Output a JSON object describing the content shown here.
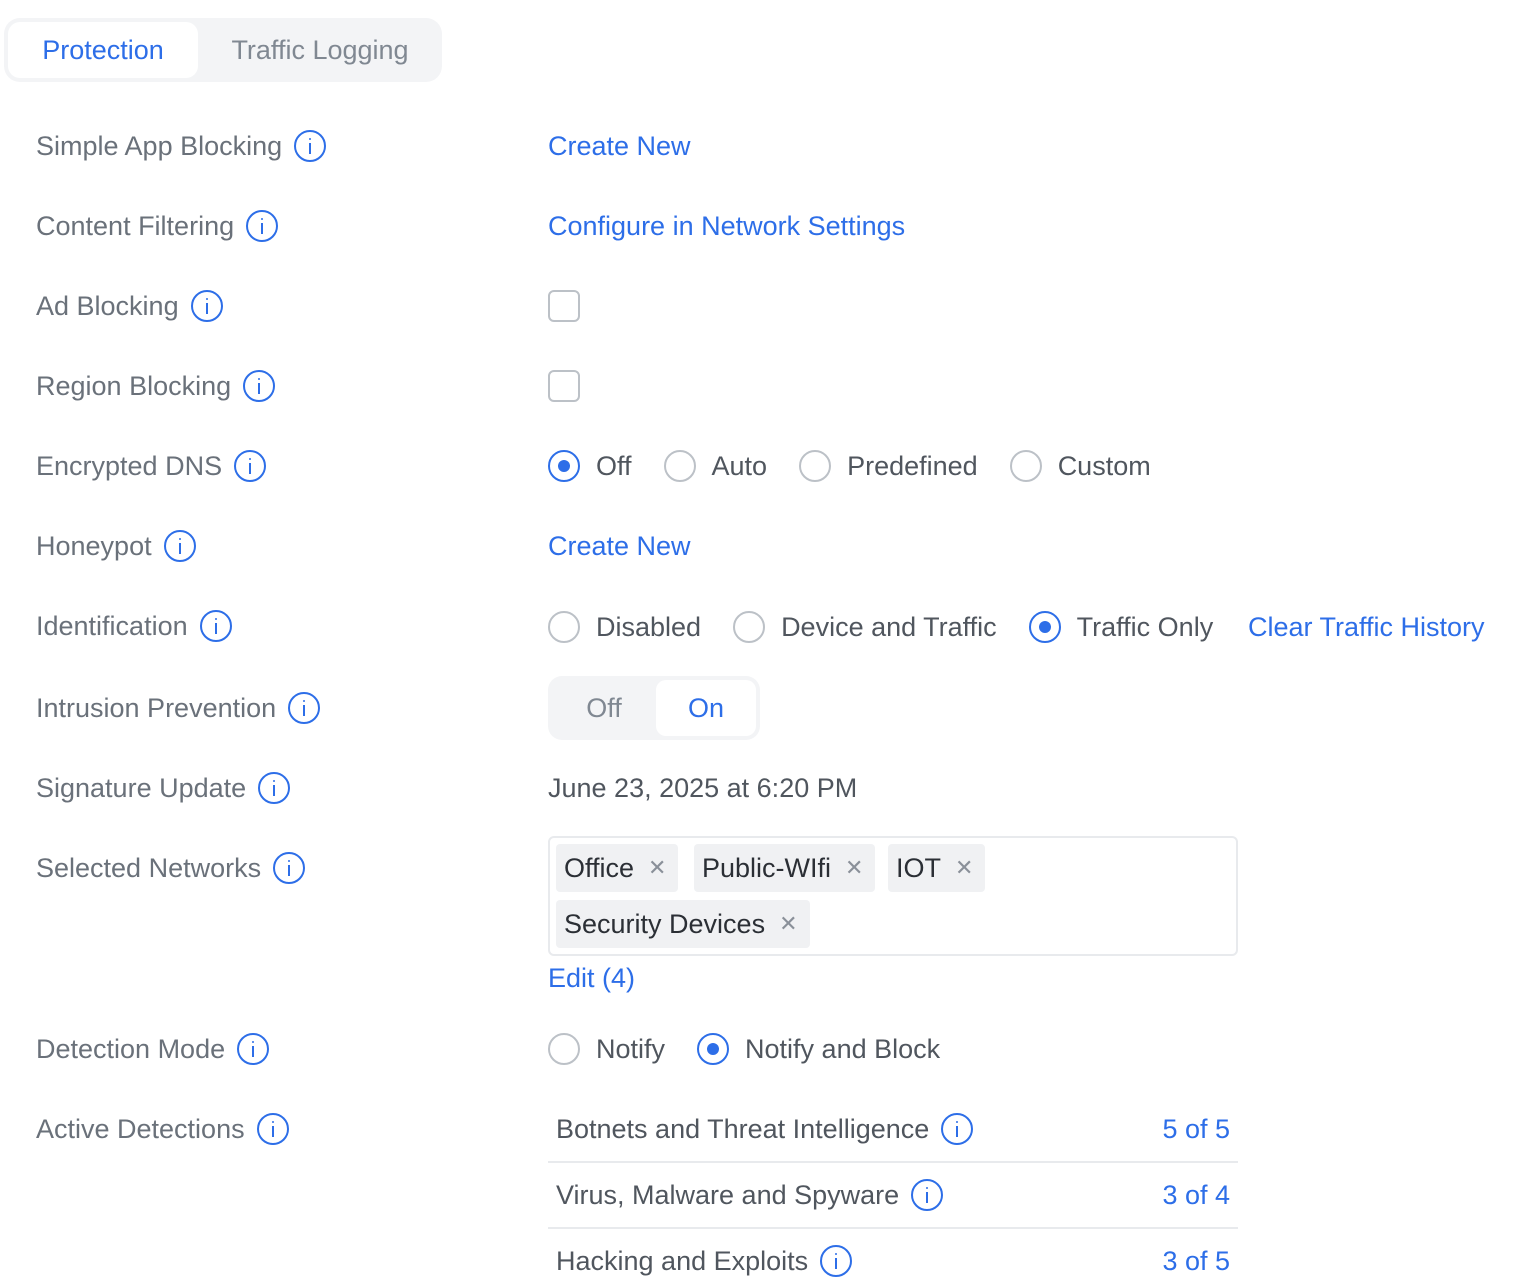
{
  "tabs": {
    "protection": "Protection",
    "traffic_logging": "Traffic Logging"
  },
  "rows": {
    "simple_app_blocking": {
      "label": "Simple App Blocking",
      "action": "Create New"
    },
    "content_filtering": {
      "label": "Content Filtering",
      "action": "Configure in Network Settings"
    },
    "ad_blocking": {
      "label": "Ad Blocking"
    },
    "region_blocking": {
      "label": "Region Blocking"
    },
    "encrypted_dns": {
      "label": "Encrypted DNS",
      "options": [
        "Off",
        "Auto",
        "Predefined",
        "Custom"
      ],
      "selected": "Off"
    },
    "honeypot": {
      "label": "Honeypot",
      "action": "Create New"
    },
    "identification": {
      "label": "Identification",
      "options": [
        "Disabled",
        "Device and Traffic",
        "Traffic Only"
      ],
      "selected": "Traffic Only",
      "action": "Clear Traffic History"
    },
    "intrusion_prevention": {
      "label": "Intrusion Prevention",
      "off": "Off",
      "on": "On",
      "selected": "On"
    },
    "signature_update": {
      "label": "Signature Update",
      "value": "June 23, 2025 at 6:20 PM"
    },
    "selected_networks": {
      "label": "Selected Networks",
      "networks": [
        "Office",
        "Public-WIfi",
        "IOT",
        "Security Devices"
      ],
      "edit": "Edit (4)"
    },
    "detection_mode": {
      "label": "Detection Mode",
      "options": [
        "Notify",
        "Notify and Block"
      ],
      "selected": "Notify and Block"
    },
    "active_detections": {
      "label": "Active Detections",
      "items": [
        {
          "name": "Botnets and Threat Intelligence",
          "count": "5 of 5"
        },
        {
          "name": "Virus, Malware and Spyware",
          "count": "3 of 4"
        },
        {
          "name": "Hacking and Exploits",
          "count": "3 of 5"
        }
      ]
    }
  },
  "colors": {
    "accent": "#2d6ee8",
    "label": "#6a717a",
    "text": "#50565e",
    "border": "#bcc1c7"
  }
}
